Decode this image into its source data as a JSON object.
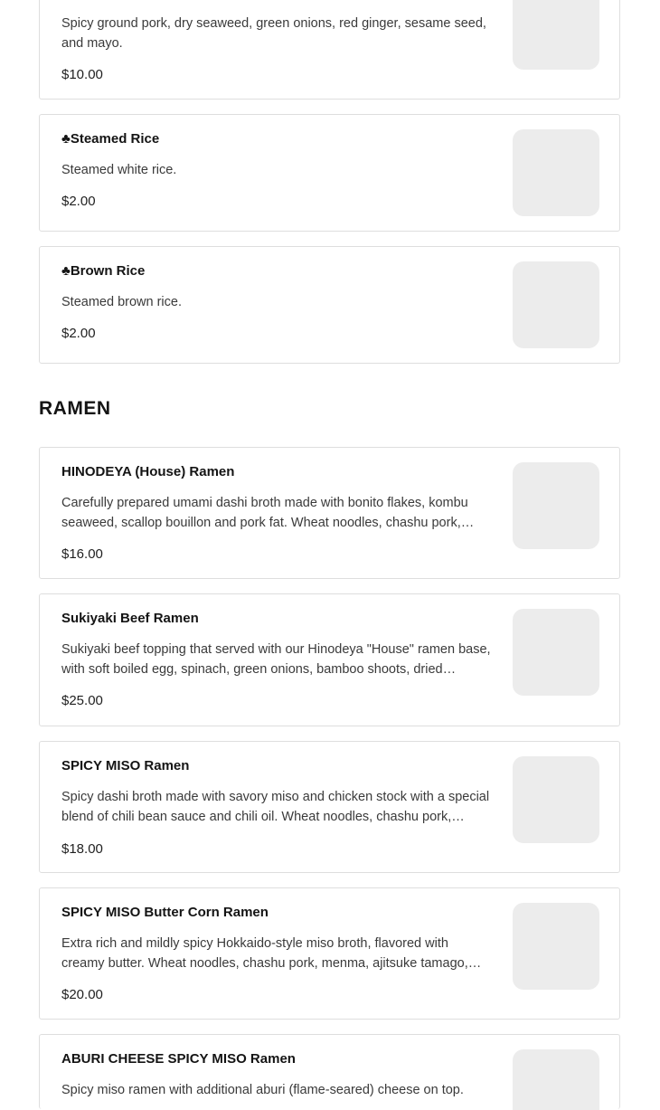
{
  "items_top": [
    {
      "description": "Spicy ground pork, dry seaweed, green onions, red ginger, sesame seed, and mayo.",
      "price": "$10.00"
    },
    {
      "name": "♣Steamed Rice",
      "description": "Steamed white rice.",
      "price": "$2.00"
    },
    {
      "name": "♣Brown Rice",
      "description": "Steamed brown rice.",
      "price": "$2.00"
    }
  ],
  "section": {
    "title": "RAMEN"
  },
  "ramen": [
    {
      "name": "HINODEYA (House) Ramen",
      "description": "Carefully prepared umami dashi broth made with bonito flakes, kombu seaweed, scallop bouillon and pork fat. Wheat noodles, chashu pork, menma, ajitsuke tamago, green onions and nori.",
      "price": "$16.00"
    },
    {
      "name": "Sukiyaki Beef Ramen",
      "description": "Sukiyaki beef topping that served with our Hinodeya \"House\" ramen base, with soft boiled egg, spinach, green onions, bamboo shoots, dried seaweed.",
      "price": "$25.00"
    },
    {
      "name": "SPICY MISO Ramen",
      "description": "Spicy dashi broth made with savory miso and chicken stock with a special blend of chili bean sauce and chili oil. Wheat noodles, chashu pork, menma, ajitsuke tamago and green onions.",
      "price": "$18.00"
    },
    {
      "name": "SPICY MISO Butter Corn Ramen",
      "description": "Extra rich and mildly spicy Hokkaido-style miso broth, flavored with creamy butter. Wheat noodles, chashu pork, menma, ajitsuke tamago, corn and green onions.",
      "price": "$20.00"
    },
    {
      "name": "ABURI CHEESE SPICY MISO Ramen",
      "description": "Spicy miso ramen with additional aburi (flame-seared) cheese on top."
    }
  ]
}
